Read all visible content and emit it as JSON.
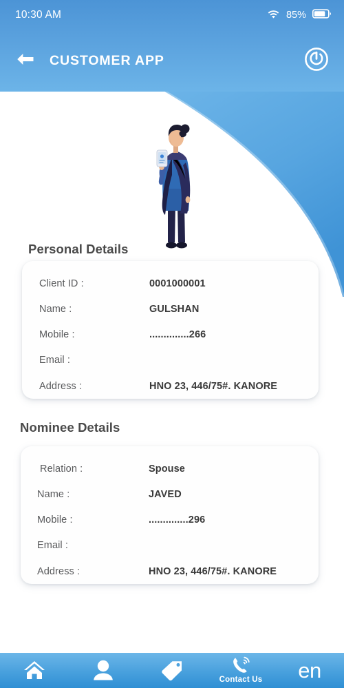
{
  "statusbar": {
    "time": "10:30 AM",
    "battery_percent": "85%",
    "wifi_icon": "wifi-icon",
    "battery_icon": "battery-icon"
  },
  "appbar": {
    "title": "CUSTOMER APP",
    "back_icon": "back-arrow-icon",
    "power_icon": "power-icon"
  },
  "illustration": {
    "name": "woman-with-phone-illustration"
  },
  "theme": {
    "header_blue": "#4c94d6",
    "accent_blue": "#6cb4e8",
    "nav_blue": "#48a0dd",
    "card_bg": "#fefefe",
    "label_color": "#58595b",
    "value_color": "#3a3a3a"
  },
  "personal": {
    "title": "Personal Details",
    "rows": [
      {
        "label": "Client ID :",
        "value": "0001000001"
      },
      {
        "label": "Name :",
        "value": "GULSHAN"
      },
      {
        "label": "Mobile :",
        "value": "..............266"
      },
      {
        "label": "Email :",
        "value": ""
      },
      {
        "label": "Address :",
        "value": "HNO 23, 446/75#. KANORE"
      }
    ]
  },
  "nominee": {
    "title": "Nominee Details",
    "rows": [
      {
        "label": "Relation :",
        "value": "Spouse"
      },
      {
        "label": "Name :",
        "value": "JAVED"
      },
      {
        "label": "Mobile :",
        "value": "..............296"
      },
      {
        "label": "Email :",
        "value": ""
      },
      {
        "label": "Address :",
        "value": "HNO 23, 446/75#. KANORE"
      }
    ]
  },
  "bottomnav": {
    "items": [
      {
        "name": "home",
        "icon": "home-icon",
        "label": ""
      },
      {
        "name": "profile",
        "icon": "person-icon",
        "label": ""
      },
      {
        "name": "offers",
        "icon": "tag-icon",
        "label": ""
      },
      {
        "name": "contact-us",
        "icon": "phone-icon",
        "label": "Contact Us"
      },
      {
        "name": "language",
        "icon": "language-text",
        "label": "en"
      }
    ]
  }
}
